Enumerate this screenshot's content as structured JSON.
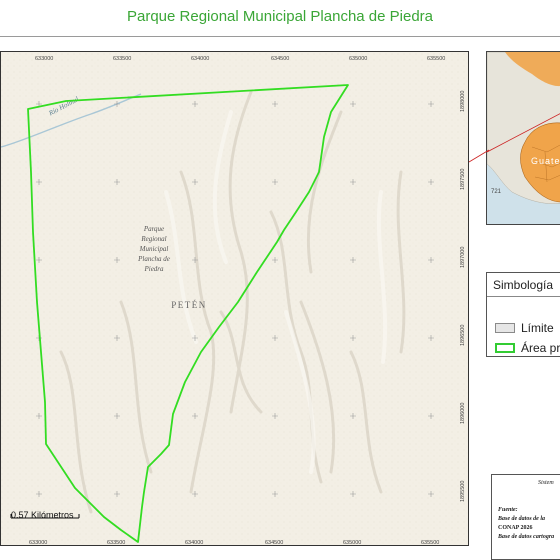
{
  "map_title": "Parque Regional Municipal Plancha de Piedra",
  "area_label_lines": [
    "Parque",
    "Regional",
    "Municipal",
    "Plancha de",
    "Piedra"
  ],
  "region_label": "PETÉN",
  "river_label": "Río Holmul",
  "x_ticks": [
    "633000",
    "633500",
    "634000",
    "634500",
    "635000",
    "635500"
  ],
  "x_ticks_bottom": [
    "633000",
    "633500",
    "634000",
    "634500",
    "635000",
    "635500"
  ],
  "y_ticks": [
    "1898000",
    "1897500",
    "1897000",
    "1896500",
    "1896000",
    "1895500"
  ],
  "scale_label": "0.57 Kilómetros",
  "inset": {
    "country_label": "Guate",
    "road_label": "721"
  },
  "legend": {
    "title": "Simbología",
    "items": [
      {
        "label": "Límite",
        "fill": "#e6e6e6",
        "stroke": "#8a8a8a"
      },
      {
        "label": "Área pr",
        "fill": "#ffffff",
        "stroke": "#33cc33"
      }
    ]
  },
  "info": {
    "heading": "Sistem",
    "lines": [
      "Fuente:",
      "Base de datos de la",
      "CONAP 2026",
      "Base de datos cartogra"
    ]
  },
  "colors": {
    "title": "#3aa636",
    "boundary": "#33dd22",
    "inset_highlight": "#f0a44a",
    "inset_pointer": "#cc2222"
  }
}
